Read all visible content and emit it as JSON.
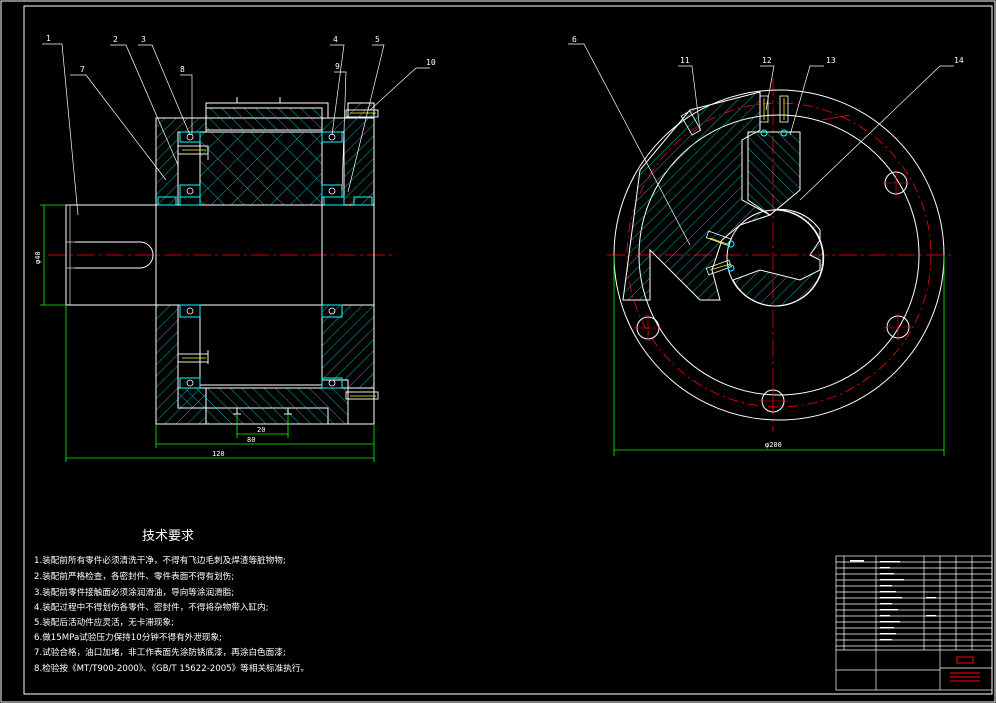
{
  "colors": {
    "background": "#000000",
    "outline": "#ffffff",
    "hatch": "#00d7d7",
    "bearing": "#00ffff",
    "dimension": "#00ff00",
    "centerline": "#ff0000",
    "leader": "#ffffff",
    "highlight": "#ffff00",
    "stamp": "#ff0000"
  },
  "callouts": {
    "n1": "1",
    "n2": "2",
    "n3": "3",
    "n4": "4",
    "n5": "5",
    "n6": "6",
    "n7": "7",
    "n8": "8",
    "n9": "9",
    "n10": "10",
    "n11": "11",
    "n12": "12",
    "n13": "13",
    "n14": "14"
  },
  "dimensions": {
    "shaft_dia": "φ40",
    "width_20": "20",
    "width_80": "80",
    "width_120": "120",
    "outer_dia": "φ200"
  },
  "requirements": {
    "title": "技术要求",
    "lines": [
      "1.装配前所有零件必须清洗干净，不得有飞边毛刺及焊渣等脏物物;",
      "2.装配前严格检查，各密封件、零件表面不得有划伤;",
      "3.装配前零件接触面必须涂润滑油，导向等涂润滑脂;",
      "4.装配过程中不得划伤各零件、密封件，不得将杂物带入缸内;",
      "5.装配后活动件应灵活，无卡滞现象;",
      "6.做15MPa试验压力保持10分钟不得有外泄现象;",
      "7.试验合格，油口加堵，非工作表面先涂防锈底漆，再涂白色面漆;",
      "8.检验按《MT/T900-2000》、《GB/T 15622-2005》等相关标准执行。"
    ]
  }
}
